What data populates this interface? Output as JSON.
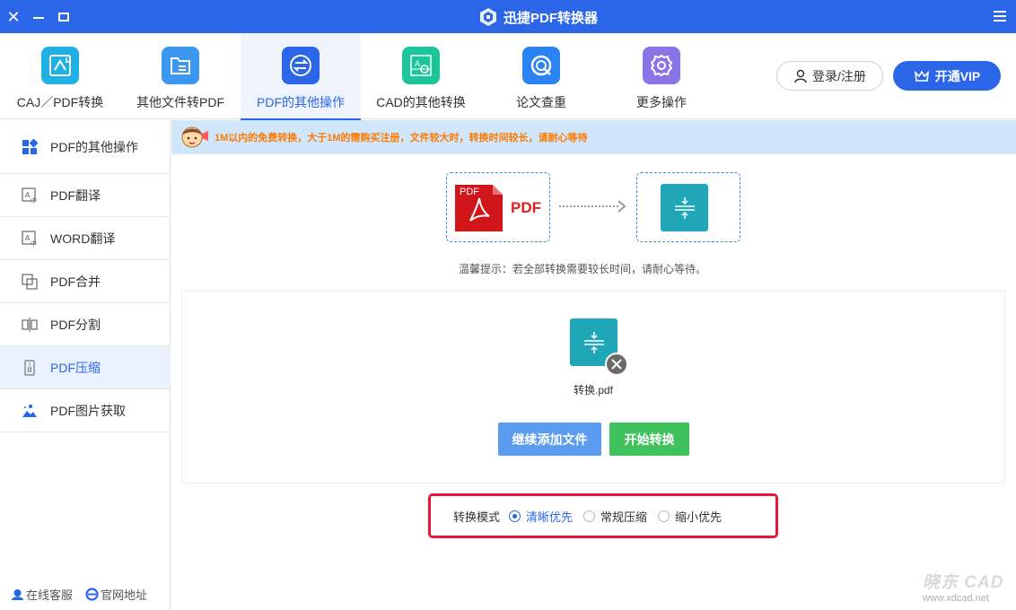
{
  "window": {
    "title": "迅捷PDF转换器"
  },
  "toolbar": {
    "tools": [
      {
        "label": "CAJ／PDF转换",
        "icon": "caj-pdf-icon",
        "color": "#1fb0e6"
      },
      {
        "label": "其他文件转PDF",
        "icon": "folder-icon",
        "color": "#3b97f0"
      },
      {
        "label": "PDF的其他操作",
        "icon": "exchange-icon",
        "color": "#2b66e9"
      },
      {
        "label": "CAD的其他转换",
        "icon": "cad-icon",
        "color": "#1cc59a"
      },
      {
        "label": "论文查重",
        "icon": "search-check-icon",
        "color": "#2a83f0"
      },
      {
        "label": "更多操作",
        "icon": "gear-icon",
        "color": "#8a74e6"
      }
    ],
    "login_label": "登录/注册",
    "vip_label": "开通VIP"
  },
  "sidebar": {
    "items": [
      {
        "label": "PDF的其他操作",
        "icon": "grid-icon"
      },
      {
        "label": "PDF翻译",
        "icon": "translate-icon"
      },
      {
        "label": "WORD翻译",
        "icon": "translate-icon"
      },
      {
        "label": "PDF合并",
        "icon": "merge-icon"
      },
      {
        "label": "PDF分割",
        "icon": "split-icon"
      },
      {
        "label": "PDF压缩",
        "icon": "compress-icon"
      },
      {
        "label": "PDF图片获取",
        "icon": "image-extract-icon"
      }
    ],
    "footer": {
      "service_label": "在线客服",
      "website_label": "官网地址"
    }
  },
  "notice": {
    "text": "1M以内的免费转换，大于1M的需购买注册，文件较大时，转换时间较长，请耐心等待"
  },
  "flow": {
    "source_badge": "PDF",
    "source_label": "PDF"
  },
  "tip": "温馨提示：若全部转换需要较长时间，请耐心等待。",
  "file": {
    "name": "转换.pdf"
  },
  "buttons": {
    "add_files": "继续添加文件",
    "start": "开始转换"
  },
  "mode": {
    "label": "转换模式",
    "options": [
      {
        "label": "清晰优先",
        "checked": true
      },
      {
        "label": "常规压缩",
        "checked": false
      },
      {
        "label": "缩小优先",
        "checked": false
      }
    ]
  },
  "watermark": {
    "main": "晓东 CAD",
    "url": "www.xdcad.net"
  },
  "colors": {
    "brand_blue": "#2b66e9",
    "green": "#3fc25d",
    "highlight_red": "#e8163b",
    "notice_orange": "#ff7a00"
  }
}
